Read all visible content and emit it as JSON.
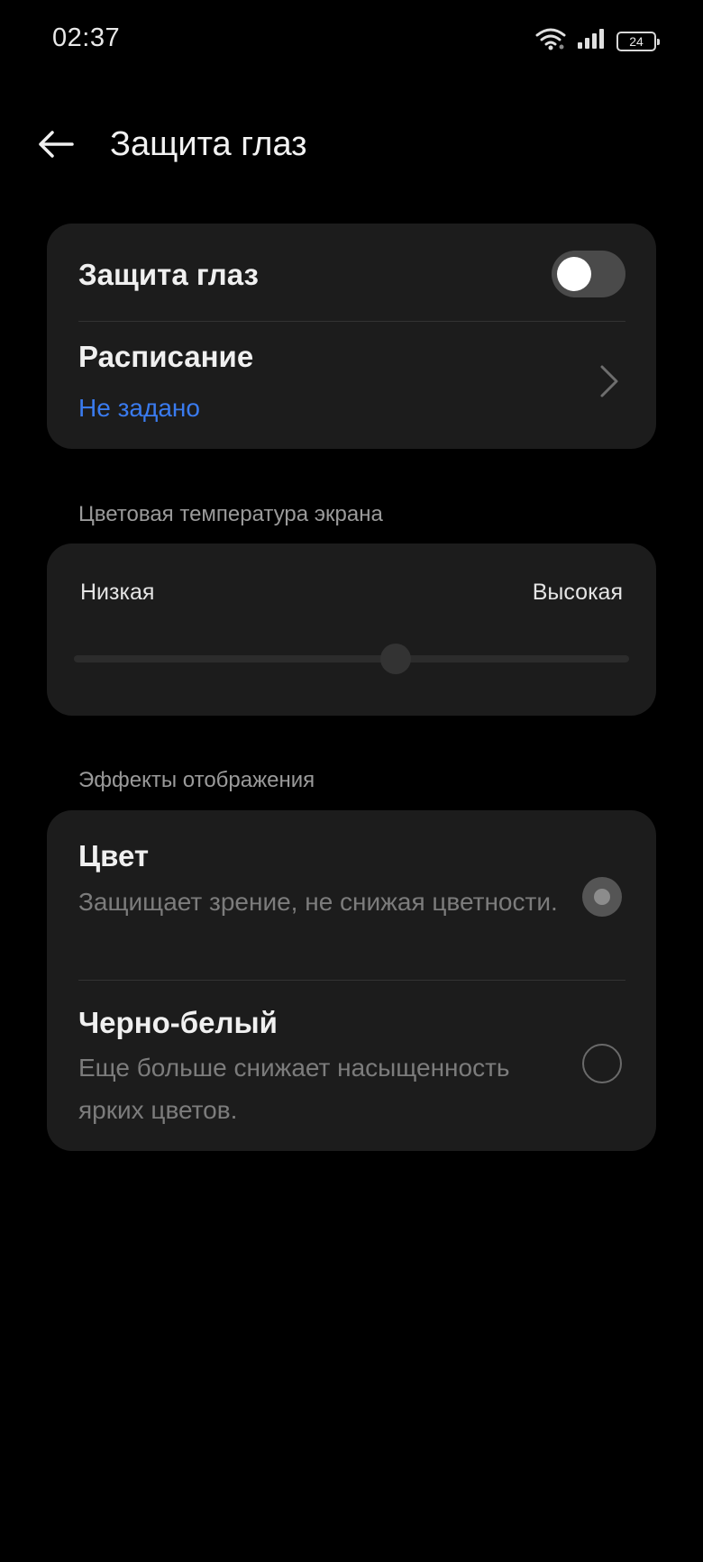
{
  "status_bar": {
    "time": "02:37",
    "battery_level": "24",
    "icons": [
      "wifi-icon",
      "signal-icon",
      "battery-icon"
    ]
  },
  "header": {
    "back_icon": "arrow-left-icon",
    "title": "Защита глаз"
  },
  "eye_protection": {
    "toggle_label": "Защита глаз",
    "toggle_on": false,
    "schedule_label": "Расписание",
    "schedule_value": "Не задано",
    "schedule_icon": "chevron-right-icon"
  },
  "color_temperature": {
    "section_label": "Цветовая температура экрана",
    "low_label": "Низкая",
    "high_label": "Высокая",
    "value_fraction": 0.58
  },
  "display_effects": {
    "section_label": "Эффекты отображения",
    "options": [
      {
        "title": "Цвет",
        "description": "Защищает зрение, не снижая цветности.",
        "selected": true
      },
      {
        "title": "Черно-белый",
        "description": "Еще больше снижает насыщенность ярких цветов.",
        "selected": false
      }
    ]
  },
  "colors": {
    "background": "#000000",
    "card": "#1c1c1c",
    "accent": "#3a7bef",
    "secondary_text": "#7c7c7c"
  }
}
